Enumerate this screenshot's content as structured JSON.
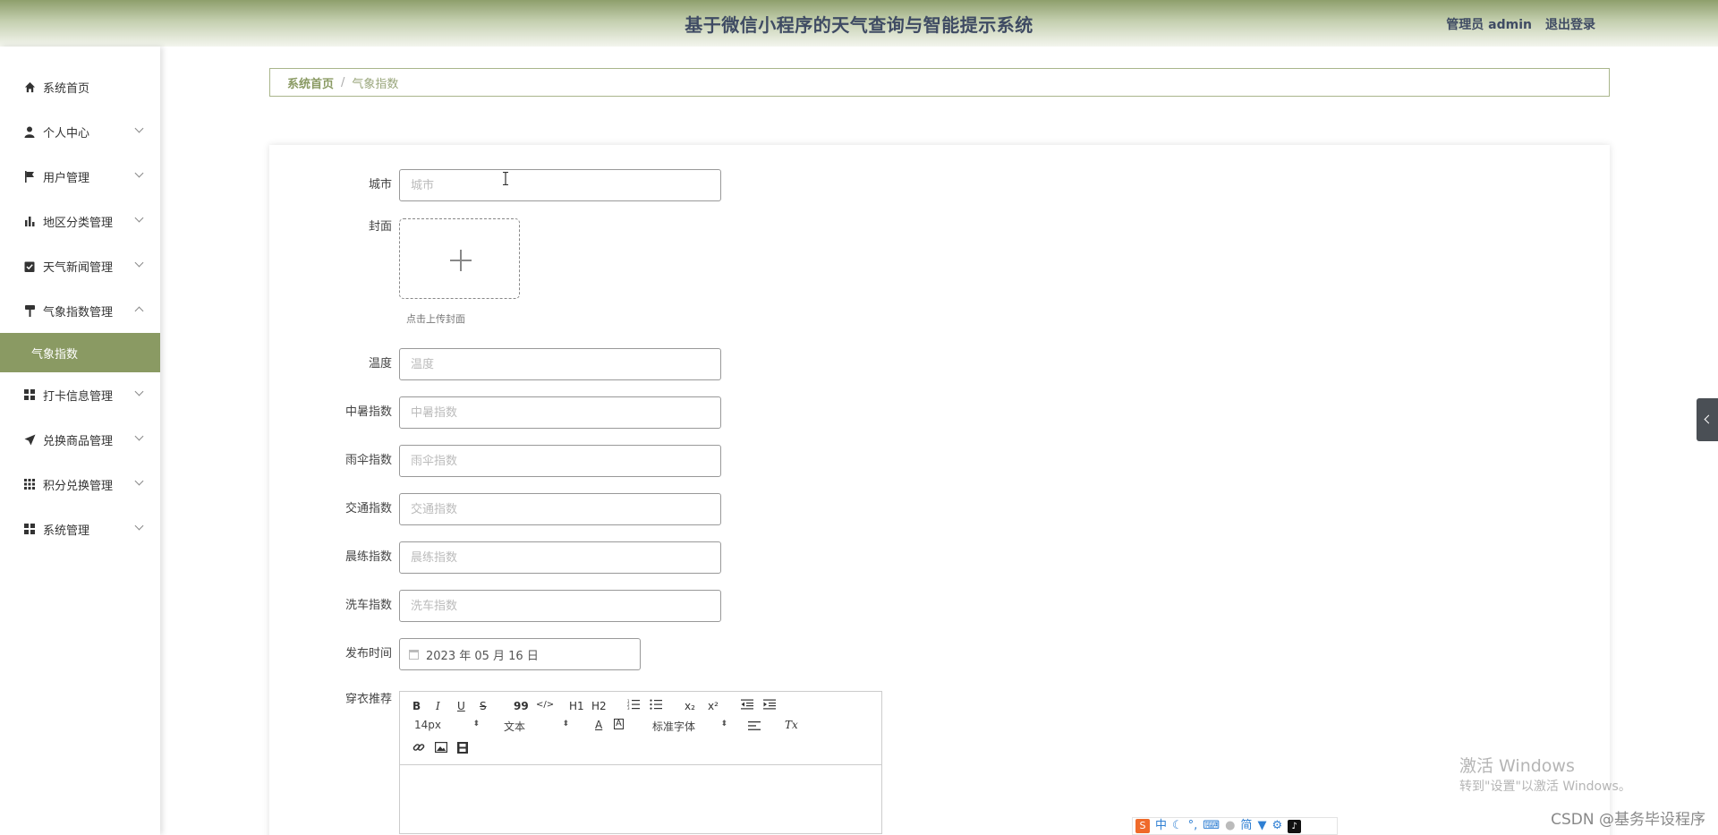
{
  "header": {
    "title": "基于微信小程序的天气查询与智能提示系统",
    "user": "管理员 admin",
    "logout": "退出登录"
  },
  "sidebar": {
    "items": [
      {
        "label": "系统首页",
        "icon": "home-icon"
      },
      {
        "label": "个人中心",
        "icon": "user-icon"
      },
      {
        "label": "用户管理",
        "icon": "flag-icon"
      },
      {
        "label": "地区分类管理",
        "icon": "bar-chart-icon"
      },
      {
        "label": "天气新闻管理",
        "icon": "clipboard-check-icon"
      },
      {
        "label": "气象指数管理",
        "icon": "paint-roller-icon"
      },
      {
        "label": "打卡信息管理",
        "icon": "grid-icon"
      },
      {
        "label": "兑换商品管理",
        "icon": "paper-plane-icon"
      },
      {
        "label": "积分兑换管理",
        "icon": "grid-dots-icon"
      },
      {
        "label": "系统管理",
        "icon": "grid-icon"
      }
    ],
    "active_sub": "气象指数"
  },
  "breadcrumb": {
    "home": "系统首页",
    "sep": "/",
    "current": "气象指数"
  },
  "form": {
    "city": {
      "label": "城市",
      "placeholder": "城市"
    },
    "cover": {
      "label": "封面",
      "hint": "点击上传封面"
    },
    "temperature": {
      "label": "温度",
      "placeholder": "温度"
    },
    "heatstroke": {
      "label": "中暑指数",
      "placeholder": "中暑指数"
    },
    "umbrella": {
      "label": "雨伞指数",
      "placeholder": "雨伞指数"
    },
    "traffic": {
      "label": "交通指数",
      "placeholder": "交通指数"
    },
    "exercise": {
      "label": "晨练指数",
      "placeholder": "晨练指数"
    },
    "carwash": {
      "label": "洗车指数",
      "placeholder": "洗车指数"
    },
    "publish_time": {
      "label": "发布时间",
      "value": "2023 年 05 月 16 日"
    },
    "clothing": {
      "label": "穿衣推荐"
    }
  },
  "editor": {
    "font_size": "14px",
    "paragraph": "文本",
    "font_family": "标准字体",
    "buttons": {
      "bold": "B",
      "italic": "I",
      "underline": "U",
      "strike": "S",
      "quote": "99",
      "code": "</>",
      "h1": "H1",
      "h2": "H2",
      "sub": "x₂",
      "sup": "x²",
      "clear": "Tx",
      "color": "A",
      "bg": "A"
    }
  },
  "watermark": {
    "line1": "激活 Windows",
    "line2": "转到\"设置\"以激活 Windows。",
    "csdn": "CSDN @基务毕设程序"
  },
  "ime": {
    "chinese": "中",
    "simplified": "简"
  }
}
